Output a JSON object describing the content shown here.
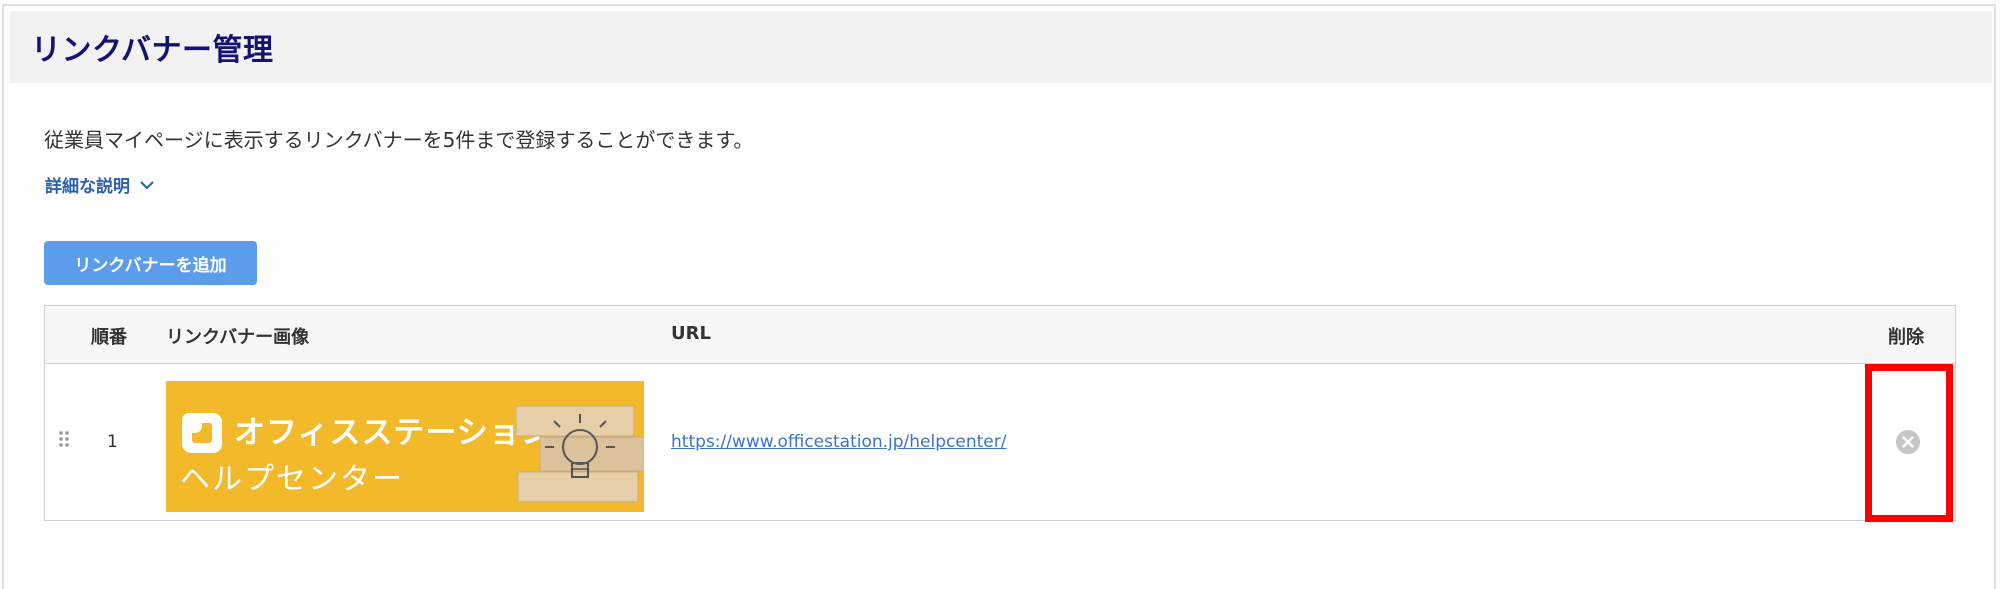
{
  "header": {
    "title": "リンクバナー管理"
  },
  "description": "従業員マイページに表示するリンクバナーを5件まで登録することができます。",
  "details_toggle": {
    "label": "詳細な説明",
    "icon": "chevron-down-icon"
  },
  "add_button": {
    "label": "リンクバナーを追加"
  },
  "table": {
    "columns": {
      "order": "順番",
      "image": "リンクバナー画像",
      "url": "URL",
      "delete": "削除"
    },
    "rows": [
      {
        "order": "1",
        "banner": {
          "title": "オフィスステーション",
          "subtitle": "ヘルプセンター"
        },
        "url": "https://www.officestation.jp/helpcenter/"
      }
    ]
  },
  "colors": {
    "title": "#14146e",
    "link": "#3d72c9",
    "button": "#5b9ceb",
    "banner_bg": "#f2b92a",
    "highlight": "#ff0000"
  }
}
